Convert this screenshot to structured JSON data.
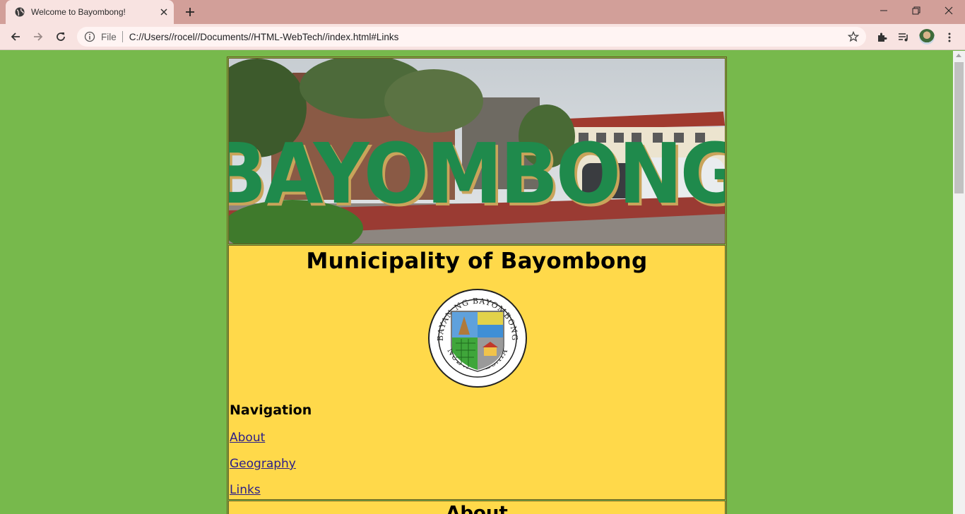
{
  "browser": {
    "tab_title": "Welcome to Bayombong!",
    "url_scheme": "File",
    "url": "C://Users//rocel//Documents//HTML-WebTech//index.html#Links"
  },
  "page": {
    "title": "Municipality of Bayombong",
    "banner_text": "BAYOMBONG",
    "seal": {
      "top_text": "BAYAN NG BAYOMBONG",
      "bottom_text": "NUEVA VIZCAYA"
    },
    "navigation": {
      "heading": "Navigation",
      "links": [
        "About",
        "Geography",
        "Links"
      ]
    },
    "next_section_title": "About"
  },
  "colors": {
    "page_background": "#77b94c",
    "cell_background": "#ffd94a",
    "link": "#2a1d8a",
    "tab_strip": "#d29f99",
    "toolbar": "#f8e3e1"
  }
}
